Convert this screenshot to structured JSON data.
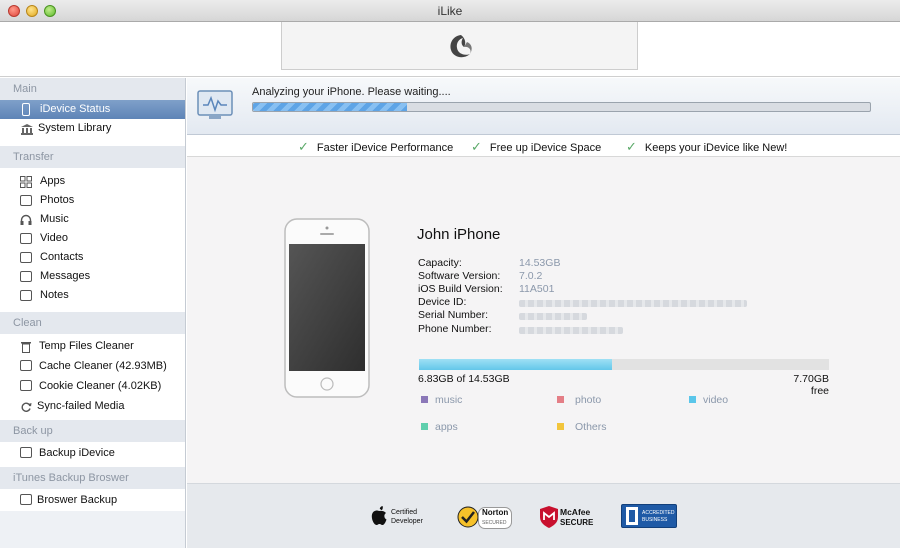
{
  "window": {
    "title": "iLike"
  },
  "sidebar": {
    "sections": [
      {
        "title": "Main",
        "items": [
          "iDevice Status",
          "System Library"
        ]
      },
      {
        "title": "Transfer",
        "items": [
          "Apps",
          "Photos",
          "Music",
          "Video",
          "Contacts",
          "Messages",
          "Notes"
        ]
      },
      {
        "title": "Clean",
        "items": [
          "Temp Files Cleaner",
          "Cache Cleaner (42.93MB)",
          "Cookie Cleaner (4.02KB)",
          "Sync-failed Media"
        ]
      },
      {
        "title": "Back up",
        "items": [
          "Backup iDevice"
        ]
      },
      {
        "title": "iTunes Backup Broswer",
        "items": [
          "Broswer Backup"
        ]
      }
    ],
    "active_item": "iDevice Status"
  },
  "analysis": {
    "status_text": "Analyzing your iPhone. Please waiting....",
    "progress_fraction": 0.25
  },
  "features": [
    "Faster iDevice Performance",
    "Free up iDevice Space",
    "Keeps your iDevice like New!"
  ],
  "device": {
    "name": "John iPhone",
    "capacity_label": "Capacity:",
    "capacity": "14.53GB",
    "software_label": "Software Version:",
    "software": "7.0.2",
    "build_label": "iOS Build Version:",
    "build": "11A501",
    "device_id_label": "Device ID:",
    "serial_label": "Serial Number:",
    "phone_label": "Phone Number:"
  },
  "storage": {
    "used_text": "6.83GB of 14.53GB",
    "free_text": "7.70GB free",
    "used_fraction": 0.47,
    "legend": [
      {
        "label": "music",
        "color": "#8b78b8"
      },
      {
        "label": "photo",
        "color": "#e47e86"
      },
      {
        "label": "video",
        "color": "#5ac6ea"
      },
      {
        "label": "apps",
        "color": "#5fcfad"
      },
      {
        "label": "Others",
        "color": "#f2c53c"
      }
    ]
  },
  "footer_badges": {
    "apple_line1": "Certified",
    "apple_line2": "Developer",
    "norton_line1": "Norton",
    "norton_line2": "SECURED",
    "mcafee_line1": "McAfee",
    "mcafee_line2": "SECURE",
    "bbb_line1": "ACCREDITED",
    "bbb_line2": "BUSINESS"
  },
  "colors": {
    "accent": "#5e84b7",
    "check": "#5aa968",
    "storage": "#64c7ea"
  }
}
